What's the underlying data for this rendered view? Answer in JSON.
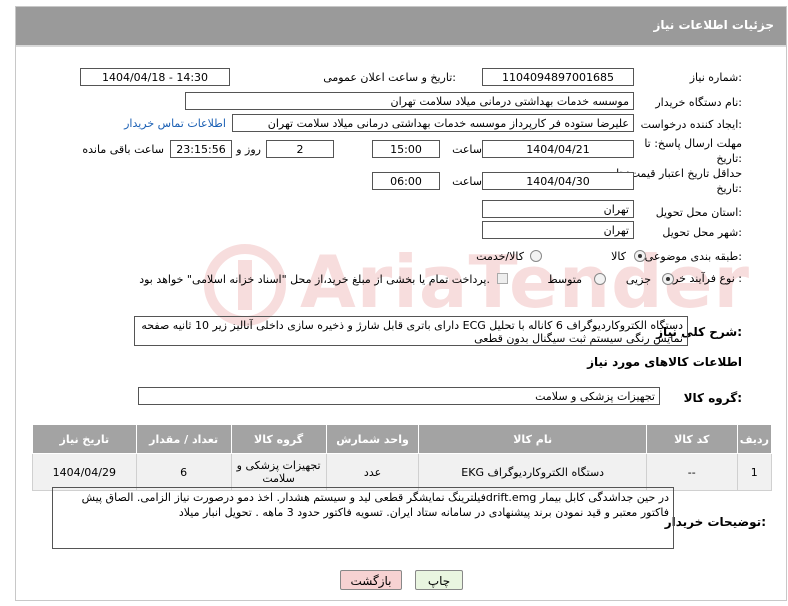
{
  "header": {
    "title": "جزئیات اطلاعات نیاز"
  },
  "need_number": {
    "label": "شماره نیاز:",
    "value": "1104094897001685"
  },
  "announce": {
    "label": "تاریخ و ساعت اعلان عمومی:",
    "value": "1404/04/18 - 14:30"
  },
  "buyer_org": {
    "label": "نام دستگاه خریدار:",
    "value": "موسسه خدمات بهداشتی درمانی میلاد سلامت تهران"
  },
  "creator": {
    "label": "ایجاد کننده درخواست:",
    "value": "علیرضا ستوده فر کارپرداز موسسه خدمات بهداشتی درمانی میلاد سلامت تهران",
    "contact_link": "اطلاعات تماس خریدار"
  },
  "reply_deadline": {
    "label": "مهلت ارسال پاسخ: تا تاریخ:",
    "date": "1404/04/21",
    "time_label": "ساعت",
    "time": "15:00",
    "days": "2",
    "days_label": "روز و",
    "remaining": "23:15:56",
    "remaining_label": "ساعت باقی مانده"
  },
  "price_validity": {
    "label": "حداقل تاریخ اعتبار قیمت: تا تاریخ:",
    "date": "1404/04/30",
    "time_label": "ساعت",
    "time": "06:00"
  },
  "province": {
    "label": "استان محل تحویل:",
    "value": "تهران"
  },
  "city": {
    "label": "شهر محل تحویل:",
    "value": "تهران"
  },
  "category": {
    "label": "طبقه بندی موضوعی:",
    "options": [
      "کالا",
      "کالا/خدمت"
    ]
  },
  "process": {
    "label": "نوع فرآیند خرید :",
    "options": [
      "جزیی",
      "متوسط"
    ],
    "payment_note": "پرداخت تمام یا بخشی از مبلغ خرید،از محل \"اسناد خزانه اسلامی\" خواهد بود."
  },
  "description": {
    "label": "شرح کلی نیاز:",
    "value": "دستگاه الکتروکاردیوگراف 6 کاناله با تحلیل ECG دارای باتری قابل شارژ و ذخیره سازی داخلی آنالیز زیر 10 ثانیه صفحه نمایش رنگی سیستم ثبت سیگنال بدون قطعی"
  },
  "goods_info": {
    "title": "اطلاعات کالاهای مورد نیاز"
  },
  "goods_group": {
    "label": "گروه کالا:",
    "value": "تجهیزات پزشکی و سلامت"
  },
  "table": {
    "headers": [
      "ردیف",
      "کد کالا",
      "نام کالا",
      "واحد شمارش",
      "گروه کالا",
      "تعداد / مقدار",
      "تاریخ نیاز"
    ],
    "rows": [
      [
        "1",
        "--",
        "دستگاه الکتروکاردیوگراف EKG",
        "عدد",
        "تجهیزات پزشکی و سلامت",
        "6",
        "1404/04/29"
      ]
    ]
  },
  "buyer_notes": {
    "label": "توضیحات خریدار:",
    "value": "در حین جداشدگی کابل بیمار drift.emgفیلترینگ نمایشگر قطعی لید و سیستم هشدار. اخذ دمو درصورت نیاز الزامی. الصاق پیش فاکتور معتبر و قید نمودن برند پیشنهادی در سامانه ستاد ایران. تسویه فاکتور حدود 3 ماهه . تحویل انبار میلاد"
  },
  "buttons": {
    "print": "چاپ",
    "back": "بازگشت"
  },
  "colors": {
    "header_bg": "#9a9a9a",
    "back_btn_bg": "#f7d2d2",
    "print_btn_bg": "#e9f5e0",
    "link": "#1a5fb4",
    "watermark": "#d03030"
  }
}
